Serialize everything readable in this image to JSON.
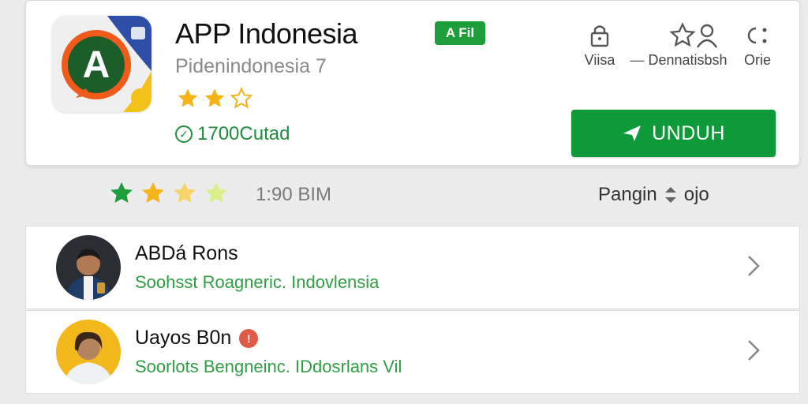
{
  "app": {
    "name": "APP Indonesia",
    "badge": "A Fil",
    "developer": "Pidenindonesia 7",
    "installs": "1700Cutad",
    "download_label": "UNDUH",
    "card_rating_stars": 2
  },
  "actions": [
    {
      "label": "Viisa",
      "icon": "lock-icon"
    },
    {
      "label": "Dennatisbsh",
      "icon": "star-outline-icon"
    },
    {
      "label": "Orie",
      "icon": "user-icon"
    }
  ],
  "rating_summary": {
    "stars": 2.5,
    "count": "1:90 BIM",
    "sort_label": "Pangin",
    "sort_suffix": "ojo"
  },
  "reviews": [
    {
      "name": "ABDá Rons",
      "subtitle": "Soohsst Roagneric. Indovlensia"
    },
    {
      "name": "Uayos B0n",
      "subtitle": "Soorlots Bengneinc. IDdosrlans Vil"
    }
  ],
  "colors": {
    "brand_green": "#0f9a3a",
    "star_gold": "#f5b41a",
    "star_green": "#1e9e3a",
    "review_text_green": "#2f9e44"
  }
}
